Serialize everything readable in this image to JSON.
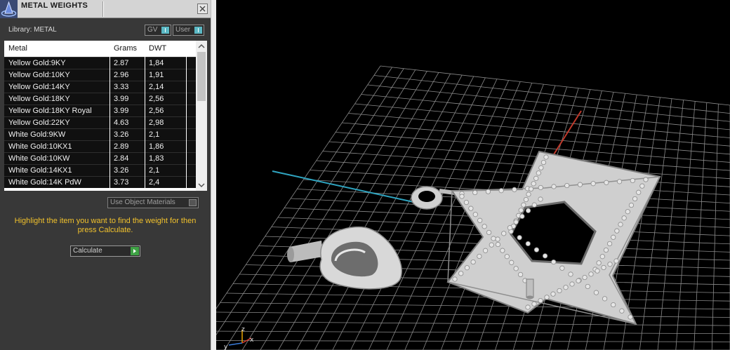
{
  "panel": {
    "title": "METAL WEIGHTS",
    "library_label": "Library: METAL",
    "gv_label": "GV",
    "user_label": "User",
    "columns": [
      "Metal",
      "Grams",
      "DWT"
    ],
    "rows": [
      {
        "metal": "Yellow Gold:9KY",
        "grams": "2.87",
        "dwt": "1,84"
      },
      {
        "metal": "Yellow Gold:10KY",
        "grams": "2.96",
        "dwt": "1,91"
      },
      {
        "metal": "Yellow Gold:14KY",
        "grams": "3.33",
        "dwt": "2,14"
      },
      {
        "metal": "Yellow Gold:18KY",
        "grams": "3.99",
        "dwt": "2,56"
      },
      {
        "metal": "Yellow Gold:18KY Royal",
        "grams": "3.99",
        "dwt": "2,56"
      },
      {
        "metal": "Yellow Gold:22KY",
        "grams": "4.63",
        "dwt": "2,98"
      },
      {
        "metal": "White Gold:9KW",
        "grams": "3.26",
        "dwt": "2,1"
      },
      {
        "metal": "White Gold:10KX1",
        "grams": "2.89",
        "dwt": "1,86"
      },
      {
        "metal": "White Gold:10KW",
        "grams": "2.84",
        "dwt": "1,83"
      },
      {
        "metal": "White Gold:14KX1",
        "grams": "3.26",
        "dwt": "2,1"
      },
      {
        "metal": "White Gold:14K PdW",
        "grams": "3.73",
        "dwt": "2,4"
      }
    ],
    "use_object_materials_label": "Use Object Materials",
    "hint": "Highlight the item you want to find the weight for then press Calculate.",
    "calculate_label": "Calculate"
  },
  "viewport": {
    "axis_labels": {
      "x": "x",
      "y": "y",
      "z": "z"
    },
    "colors": {
      "x_axis": "#c0392b",
      "y_axis": "#2fa4c0",
      "grid": "#8a8a8a",
      "background": "#000000",
      "model": "#cfcfcf"
    }
  }
}
